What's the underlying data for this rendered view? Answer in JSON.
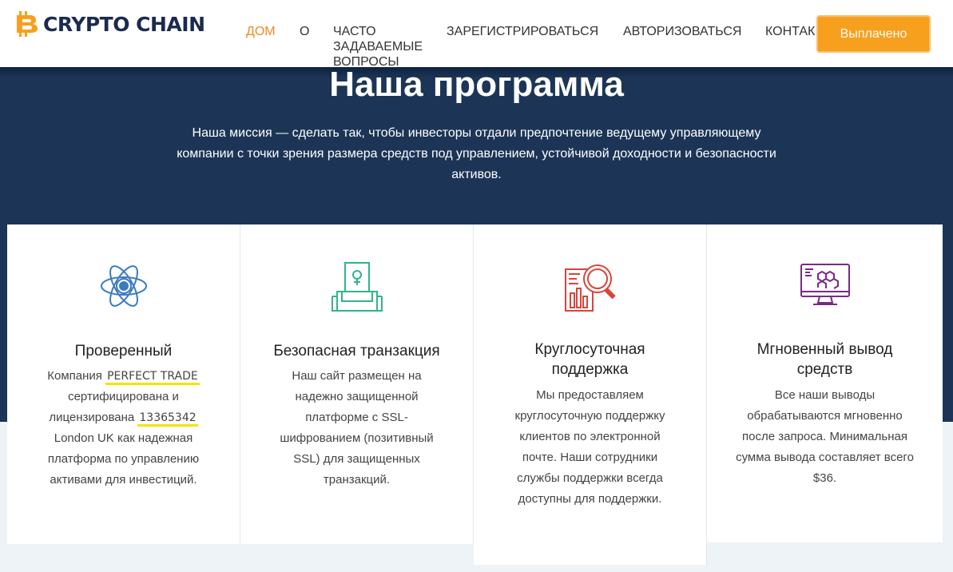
{
  "header": {
    "logo_text": "CRYPTO CHAIN",
    "nav": [
      {
        "label": "ДОМ",
        "active": true
      },
      {
        "label": "О"
      },
      {
        "label": "ЧАСТО ЗАДАВАЕМЫЕ ВОПРОСЫ"
      },
      {
        "label": "ЗАРЕГИСТРИРОВАТЬСЯ"
      },
      {
        "label": "АВТОРИЗОВАТЬСЯ"
      },
      {
        "label": "КОНТАК"
      }
    ],
    "paid_button": "Выплачено"
  },
  "hero": {
    "title_light": "Наша ",
    "title_bold": "программа",
    "text": "Наша миссия — сделать так, чтобы инвесторы отдали предпочтение ведущему управляющему компании с точки зрения размера средств под управлением, устойчивой доходности и безопасности активов."
  },
  "cards": [
    {
      "title": "Проверенный",
      "icon": "atom-icon",
      "text_1": "Компания ",
      "company": "PERFECT TRADE",
      "text_2": " сертифицирована и лицензирована ",
      "license": "13365342",
      "text_3": " London UK как надежная платформа по управлению активами для инвестиций."
    },
    {
      "title": "Безопасная транзакция",
      "icon": "secure-box-icon",
      "text": "Наш сайт размещен на надежно защищенной платформе с SSL-шифрованием (позитивный SSL) для защищенных транзакций."
    },
    {
      "title": "Круглосуточная поддержка",
      "icon": "magnifier-chart-icon",
      "text": "Мы предоставляем круглосуточную поддержку клиентов по электронной почте. Наши сотрудники службы поддержки всегда доступны для поддержки."
    },
    {
      "title": "Мгновенный вывод средств",
      "icon": "monitor-hexagon-icon",
      "text": "Все наши выводы обрабатываются мгновенно после запроса. Минимальная сумма вывода составляет всего $36."
    }
  ],
  "colors": {
    "hero_bg": "#1c3557",
    "accent_orange": "#f7a01d",
    "nav_active": "#f08a24",
    "icon_blue": "#3a7bbf",
    "icon_green": "#2fb58b",
    "icon_red": "#d8453a",
    "icon_purple": "#7a2a86",
    "highlight_yellow": "#f4e400"
  }
}
